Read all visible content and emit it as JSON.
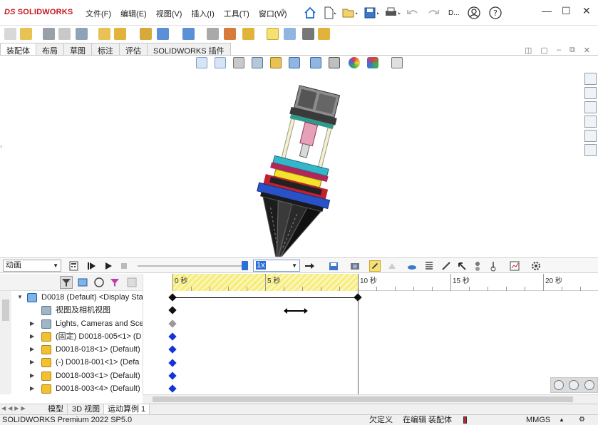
{
  "app": {
    "logo_mark": "DS",
    "logo_text": "SOLIDWORKS",
    "user_truncated": "D..."
  },
  "menu": {
    "items": [
      "文件(F)",
      "编辑(E)",
      "视图(V)",
      "插入(I)",
      "工具(T)",
      "窗口(W)"
    ]
  },
  "command_tabs": [
    "装配体",
    "布局",
    "草图",
    "标注",
    "评估",
    "SOLIDWORKS 插件"
  ],
  "motion": {
    "study_type": "动画",
    "speed_value": "1x",
    "playback_progress_fraction": 1.0
  },
  "timeline": {
    "tick_labels": [
      "0 秒",
      "5 秒",
      "10 秒",
      "15 秒",
      "20 秒"
    ],
    "duration_seconds": 10,
    "max_seconds": 23
  },
  "tree": {
    "root": "D0018 (Default) <Display Sta",
    "items": [
      {
        "label": "视图及相机视图",
        "icon": "camera-icon"
      },
      {
        "label": "Lights, Cameras and Sce",
        "icon": "scene-icon"
      },
      {
        "label": "(固定) D0018-005<1> (D",
        "icon": "part-icon"
      },
      {
        "label": "D0018-018<1> (Default)",
        "icon": "part-icon"
      },
      {
        "label": "(-) D0018-001<1> (Defa",
        "icon": "part-icon"
      },
      {
        "label": "D0018-003<1> (Default)",
        "icon": "part-icon"
      },
      {
        "label": "D0018-003<4> (Default)",
        "icon": "part-icon"
      }
    ]
  },
  "bottom_tabs": [
    "模型",
    "3D 视图",
    "运动算例 1"
  ],
  "status": {
    "version": "SOLIDWORKS Premium 2022 SP5.0",
    "definition": "欠定义",
    "mode": "在编辑 装配体",
    "units": "MMGS"
  },
  "colors": {
    "brand": "#c8161d",
    "key_blue": "#1534d6",
    "key_black": "#111111",
    "key_gray": "#9a9a9a",
    "hatch": "#f6ec7a"
  }
}
